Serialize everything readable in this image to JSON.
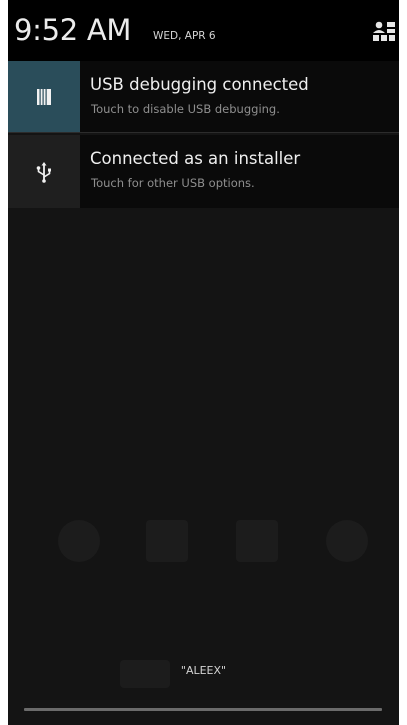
{
  "status": {
    "time": "9:52 AM",
    "date": "WED, APR 6"
  },
  "quick_settings": {
    "icon": "quick-settings-grid-icon"
  },
  "notifications": [
    {
      "title": "USB debugging connected",
      "subtitle": "Touch to disable USB debugging.",
      "icon": "android-debug-icon",
      "accent": "#2a4d5a"
    },
    {
      "title": "Connected as an installer",
      "subtitle": "Touch for other USB options.",
      "icon": "usb-icon"
    }
  ],
  "carrier": {
    "label": "\"ALEEX\""
  }
}
